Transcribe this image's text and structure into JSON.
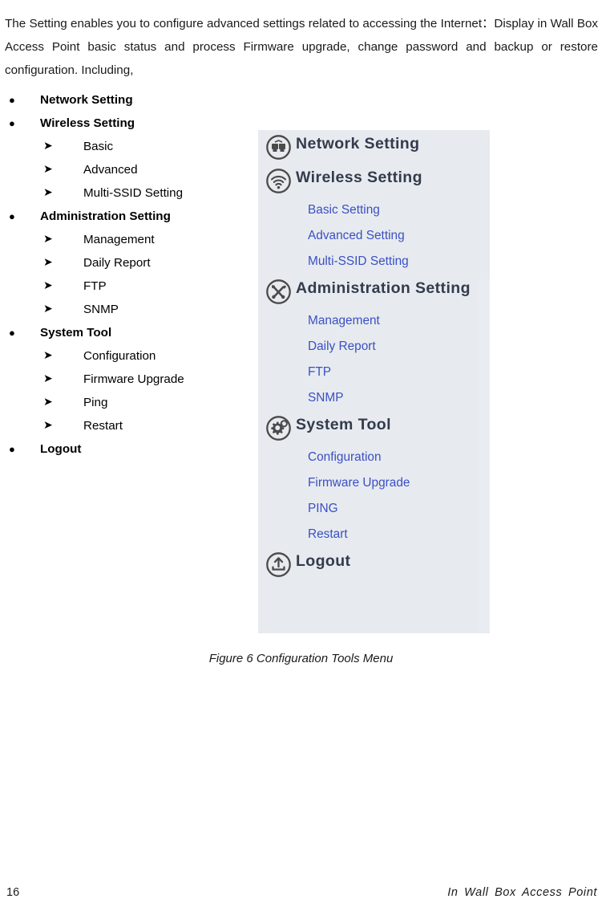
{
  "document": {
    "intro_paragraph": "The Setting enables you to configure advanced settings related to accessing the Internet：Display in Wall Box Access Point basic status and process Firmware upgrade, change password and backup or restore configuration. Including,",
    "caption": "Figure 6 Configuration Tools Menu"
  },
  "outline": {
    "bullet_marker": "●",
    "sub_marker": "➤",
    "items": [
      {
        "label": "Network Setting",
        "level": 1
      },
      {
        "label": "Wireless Setting",
        "level": 1
      },
      {
        "label": "Basic",
        "level": 2
      },
      {
        "label": "Advanced",
        "level": 2
      },
      {
        "label": "Multi-SSID Setting",
        "level": 2
      },
      {
        "label": "Administration Setting",
        "level": 1
      },
      {
        "label": "Management",
        "level": 2
      },
      {
        "label": "Daily Report",
        "level": 2
      },
      {
        "label": "FTP",
        "level": 2
      },
      {
        "label": "SNMP",
        "level": 2
      },
      {
        "label": "System Tool",
        "level": 1
      },
      {
        "label": "Configuration",
        "level": 2
      },
      {
        "label": "Firmware Upgrade",
        "level": 2
      },
      {
        "label": "Ping",
        "level": 2
      },
      {
        "label": "Restart",
        "level": 2
      },
      {
        "label": "Logout",
        "level": 1
      }
    ]
  },
  "figure_menu": {
    "background_color": "#e7ebef",
    "heading_color": "#333b4d",
    "link_color": "#3b4fc4",
    "groups": [
      {
        "label": "Network Setting",
        "icon": "network-computers-icon",
        "items": []
      },
      {
        "label": "Wireless Setting",
        "icon": "wifi-signal-icon",
        "items": [
          "Basic Setting",
          "Advanced Setting",
          "Multi-SSID Setting"
        ]
      },
      {
        "label": "Administration Setting",
        "icon": "wrench-screwdriver-icon",
        "items": [
          "Management",
          "Daily Report",
          "FTP",
          "SNMP"
        ]
      },
      {
        "label": "System Tool",
        "icon": "gears-icon",
        "items": [
          "Configuration",
          "Firmware Upgrade",
          "PING",
          "Restart"
        ]
      },
      {
        "label": "Logout",
        "icon": "logout-arrow-icon",
        "items": []
      }
    ]
  },
  "footer": {
    "page_number": "16",
    "document_name": "In Wall Box Access Point"
  }
}
